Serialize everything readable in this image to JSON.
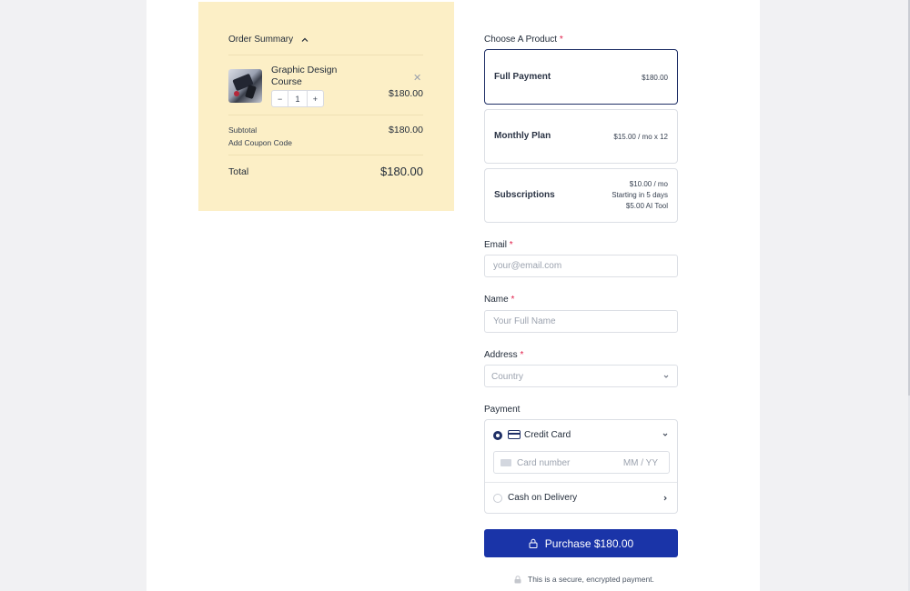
{
  "order_summary": {
    "heading": "Order Summary",
    "item": {
      "name": "Graphic Design Course",
      "quantity": "1",
      "price": "$180.00",
      "decrement": "−",
      "increment": "+",
      "remove": "✕"
    },
    "subtotal_label": "Subtotal",
    "subtotal_value": "$180.00",
    "coupon_link": "Add Coupon Code",
    "total_label": "Total",
    "total_value": "$180.00"
  },
  "product_section": {
    "label": "Choose A Product",
    "required_mark": "*",
    "options": [
      {
        "name": "Full Payment",
        "price_lines": [
          "$180.00"
        ],
        "selected": true
      },
      {
        "name": "Monthly Plan",
        "price_lines": [
          "$15.00 / mo x 12"
        ],
        "selected": false
      },
      {
        "name": "Subscriptions",
        "price_lines": [
          "$10.00 / mo",
          "Starting in 5 days",
          "$5.00 AI Tool"
        ],
        "selected": false
      }
    ]
  },
  "email": {
    "label": "Email",
    "required_mark": "*",
    "placeholder": "your@email.com"
  },
  "name": {
    "label": "Name",
    "required_mark": "*",
    "placeholder": "Your Full Name"
  },
  "address": {
    "label": "Address",
    "required_mark": "*",
    "country_placeholder": "Country"
  },
  "payment": {
    "label": "Payment",
    "credit_card": {
      "label": "Credit Card",
      "selected": true,
      "card_number_placeholder": "Card number",
      "expiry_placeholder": "MM / YY"
    },
    "cash": {
      "label": "Cash on Delivery",
      "selected": false
    }
  },
  "purchase_button": "Purchase $180.00",
  "secure_note": "This is a secure, encrypted payment.",
  "colors": {
    "summary_bg": "#fcefc6",
    "primary": "#1a34a8",
    "selected_border": "#1f2f66",
    "required": "#e11d48"
  },
  "icons": [
    "chevron-up-icon",
    "close-icon",
    "chevron-down-icon",
    "credit-card-icon",
    "chevron-right-icon",
    "lock-icon"
  ]
}
